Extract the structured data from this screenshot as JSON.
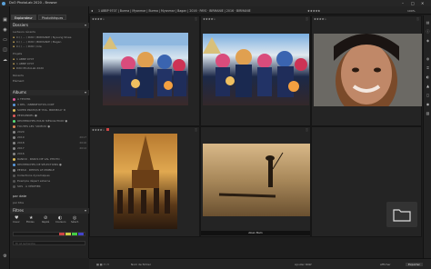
{
  "app": {
    "title": "DxO PhotoLab 2020 - Browse",
    "zoom": "100%",
    "window_controls": [
      "–",
      "□",
      "✕"
    ]
  },
  "left_panel": {
    "tabs": [
      {
        "label": "Explorateur"
      },
      {
        "label": "Photothèques"
      }
    ],
    "sections": {
      "folders": "Dossiers",
      "search": "Recherche",
      "albums": "Albums",
      "filters": "Filtres"
    },
    "folder_rows": [
      {
        "label": "Lecteurs récents"
      },
      {
        "label": "C:\\ \\ ... \\ DXO \\ BIRMANIE \\ Nyaung Shwe"
      },
      {
        "label": "C:\\ \\ ... \\ DXO \\ BIRMANIE \\ Bagan"
      },
      {
        "label": "C:\\ \\ ... \\ DXO \\ Inle"
      },
      {
        "label": "1 ABBP 9707"
      },
      {
        "label": "1 ABBP 9707"
      },
      {
        "label": "DXO PhotoLab 2020"
      }
    ],
    "search_rows": [
      {
        "label": "Projets"
      },
      {
        "label": "ABBP 9707"
      },
      {
        "label": "1 ABBP 9707"
      },
      {
        "label": "DXO PhotoLab 2020"
      }
    ],
    "project_rows": [
      {
        "label": "Récents"
      },
      {
        "label": "Élément"
      }
    ],
    "album_rows": [
      {
        "label": "À TESTER",
        "count": ""
      },
      {
        "label": "À REL. 'ABBBPHOTOS.COM'",
        "count": ""
      },
      {
        "label": "SUPER PRATIQUE 'POL. BRIMEAU' ★",
        "count": ""
      },
      {
        "label": "PERSONNEL ●",
        "count": ""
      },
      {
        "label": "RECHERCHES POUR 'RÉSOLUTION' ●",
        "count": ""
      },
      {
        "label": "TOUTES LES 'VIDÉOS' ●",
        "count": ""
      },
      {
        "label": "2020",
        "count": ""
      },
      {
        "label": "2019",
        "count": "2017"
      },
      {
        "label": "2018",
        "count": "2016"
      },
      {
        "label": "2017",
        "count": "2014"
      },
      {
        "label": "2016",
        "count": ""
      },
      {
        "label": "RANDO · PARCS DE VAL PHOTO ·",
        "count": ""
      },
      {
        "label": "RECHERCHES DE SÉLECTIONS ●",
        "count": ""
      },
      {
        "label": "PERSO · DEPUIS LE MOBILE",
        "count": ""
      },
      {
        "label": "Collections dynamiques",
        "count": ""
      },
      {
        "label": "Exemple départ externe",
        "count": ""
      },
      {
        "label": "SOS · À VÉRIFIER",
        "count": ""
      }
    ],
    "sort_label": "par date",
    "sort_sub": "par titre",
    "filter_icons": [
      "Coeur",
      "Étoiles",
      "Rejeté",
      "Couleurs",
      "Sélect."
    ],
    "search_placeholder": "Tri et recherche"
  },
  "toolbar": {
    "breadcrumb": "1 ABBP 9707 | Burma | Myanmar | Burma | Myanmar | Bagan | 2016 · PAYS · BIRMANIE | 2016 · BIRMANIE",
    "rating": "★★★★★",
    "right_buttons": [
      "Sélections",
      "Aperçu"
    ]
  },
  "grid": {
    "cells": [
      {
        "stars": "★★★★☆",
        "info": "ⓘ",
        "caption": ""
      },
      {
        "stars": "★★★★☆",
        "info": "ⓘ",
        "caption": ""
      },
      {
        "stars": "★★★★☆",
        "info": "ⓘ",
        "caption": ""
      },
      {
        "stars": "★★★★☆",
        "info": "ⓘ",
        "caption": ""
      },
      {
        "stars": "",
        "info": "ⓘ",
        "caption": "Aban Bam"
      },
      {
        "stars": "",
        "info": "",
        "caption": ""
      }
    ]
  },
  "status": {
    "left": "Nom de fichier",
    "mid": "Ajouter RAW",
    "right": "Afficher",
    "export": "Exporter"
  }
}
